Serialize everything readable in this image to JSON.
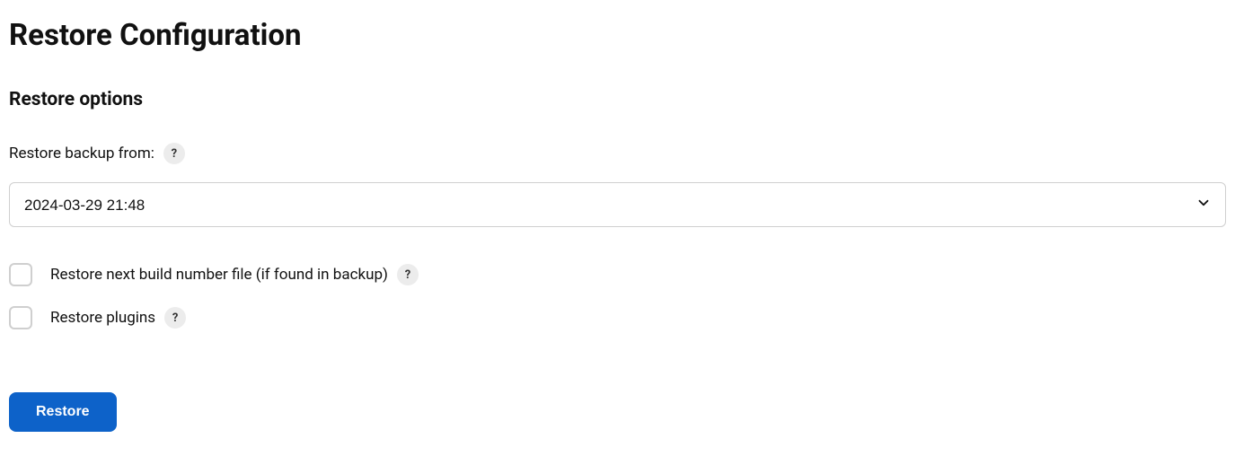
{
  "page": {
    "title": "Restore Configuration",
    "sectionTitle": "Restore options"
  },
  "form": {
    "backupLabel": "Restore backup from:",
    "backupSelected": "2024-03-29 21:48",
    "checkboxes": {
      "restoreNextBuild": {
        "label": "Restore next build number file (if found in backup)",
        "checked": false
      },
      "restorePlugins": {
        "label": "Restore plugins",
        "checked": false
      }
    },
    "submitLabel": "Restore"
  },
  "helpGlyph": "?"
}
